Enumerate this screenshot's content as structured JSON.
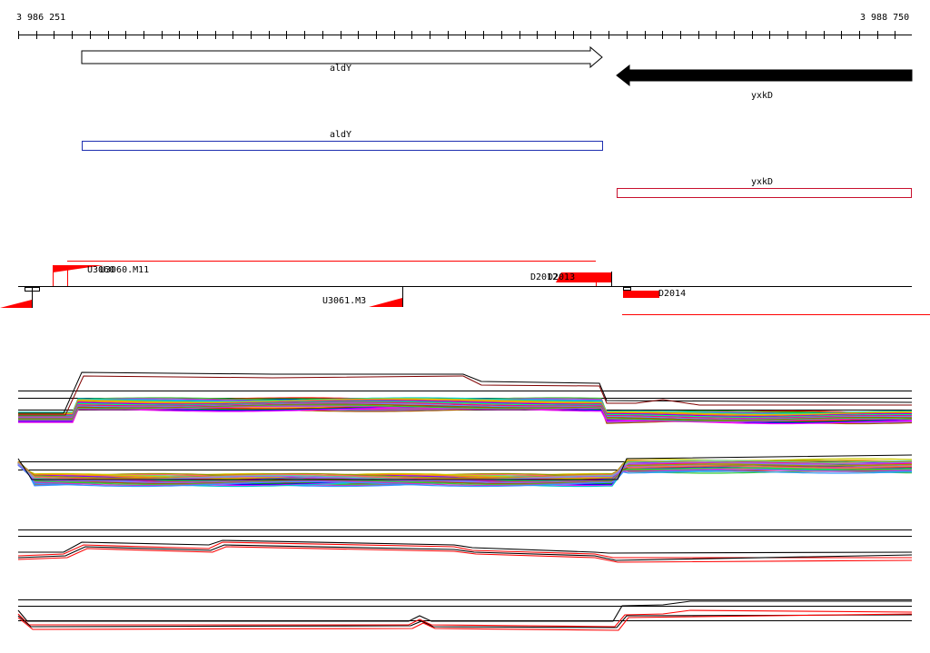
{
  "axis": {
    "start_label": "3 986 251",
    "end_label": "3 988 750",
    "start": 3986251,
    "end": 3988750
  },
  "genes": [
    {
      "name": "aldY",
      "strand": "+",
      "color": "#000000",
      "track": "annotation"
    },
    {
      "name": "yxkD",
      "strand": "-",
      "color": "#000000",
      "track": "annotation"
    }
  ],
  "cds": [
    {
      "name": "aldY",
      "color": "#1f2fb0"
    },
    {
      "name": "yxkD",
      "color": "#c8102e"
    }
  ],
  "features": {
    "forward_labels": [
      "U3060",
      "U3060.M11",
      "D2012",
      "D2013"
    ],
    "reverse_labels": [
      "U3061.M3",
      "D2014"
    ],
    "color": "#ff0000"
  },
  "expression_panels": [
    {
      "name": "multi-condition-forward",
      "style": "many-colors"
    },
    {
      "name": "multi-condition-reverse",
      "style": "many-colors"
    },
    {
      "name": "replicates-forward",
      "style": "red-black"
    },
    {
      "name": "replicates-reverse",
      "style": "red-black"
    }
  ],
  "colors": {
    "background": "#ffffff",
    "axis": "#000000",
    "feature": "#ff0000",
    "cds_forward": "#1f2fb0",
    "cds_reverse": "#c8102e"
  }
}
